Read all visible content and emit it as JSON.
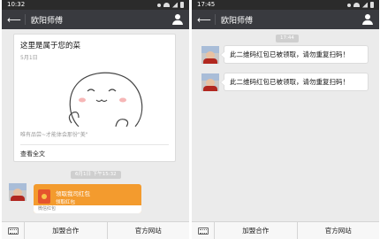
{
  "left": {
    "status": {
      "time": "10:32"
    },
    "title": "欧阳师傅",
    "article": {
      "title": "这里是属于您的菜",
      "date": "5月1日",
      "caption": "唯有品尝~才能体会那份\"美\"",
      "read_more": "查看全文"
    },
    "time_chip": "6月1日 下午15:32",
    "red_packet": {
      "title": "领取我司红包",
      "sub": "领取红包",
      "footer": "微信红包"
    },
    "menu": [
      "加盟合作",
      "官方网站"
    ]
  },
  "right": {
    "status": {
      "time": "17:45"
    },
    "title": "欧阳师傅",
    "time_chip": "17:44",
    "messages": [
      "此二维码红包已被领取，请勿重复扫码！",
      "此二维码红包已被领取，请勿重复扫码！"
    ],
    "menu": [
      "加盟合作",
      "官方网站"
    ]
  },
  "icons": [
    "back-arrow-icon",
    "person-icon",
    "keyboard-icon",
    "red-packet-icon"
  ]
}
